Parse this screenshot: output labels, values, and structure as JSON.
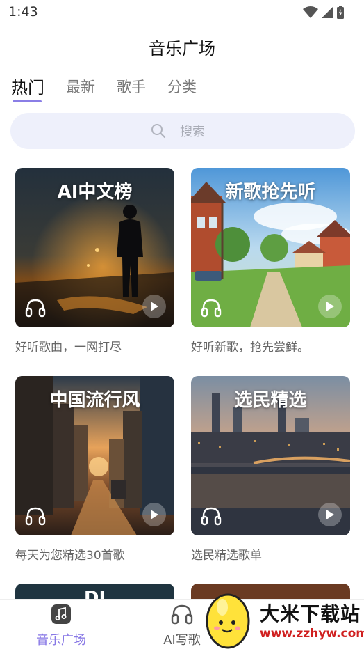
{
  "status": {
    "time": "1:43"
  },
  "page": {
    "title": "音乐广场"
  },
  "tabs": [
    {
      "label": "热门"
    },
    {
      "label": "最新"
    },
    {
      "label": "歌手"
    },
    {
      "label": "分类"
    }
  ],
  "search": {
    "placeholder": "搜索"
  },
  "cards": [
    {
      "title": "AI中文榜",
      "desc": "好听歌曲，一网打尽"
    },
    {
      "title": "新歌抢先听",
      "desc": "好听新歌，抢先尝鲜。"
    },
    {
      "title": "中国流行风",
      "desc": "每天为您精选30首歌"
    },
    {
      "title": "选民精选",
      "desc": "选民精选歌单"
    },
    {
      "title": "DJ"
    }
  ],
  "bottom_nav": [
    {
      "label": "音乐广场",
      "icon": "music-note-icon"
    },
    {
      "label": "AI写歌",
      "icon": "headphone-icon"
    }
  ],
  "watermark": {
    "title": "大米下载站",
    "url": "www.zzhyw.com"
  },
  "colors": {
    "accent": "#8a7ee6",
    "search_bg": "#eef0fb",
    "watermark_url": "#d02020"
  }
}
